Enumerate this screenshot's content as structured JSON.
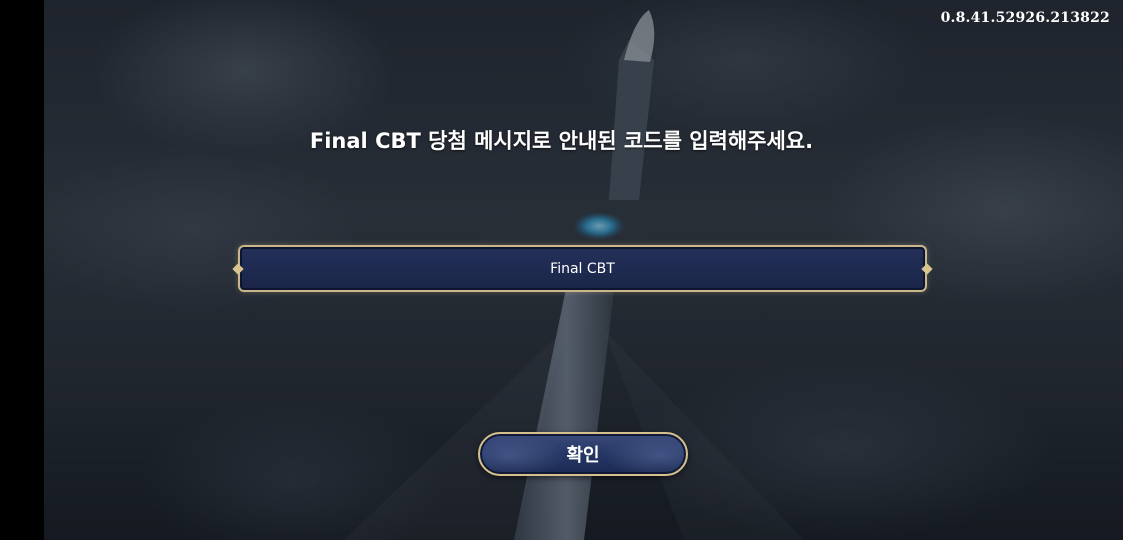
{
  "version": "0.8.41.52926.213822",
  "prompt": "Final CBT 당첨 메시지로 안내된 코드를 입력해주세요.",
  "code_input": {
    "value": "Final CBT"
  },
  "confirm_button": {
    "label": "확인"
  }
}
